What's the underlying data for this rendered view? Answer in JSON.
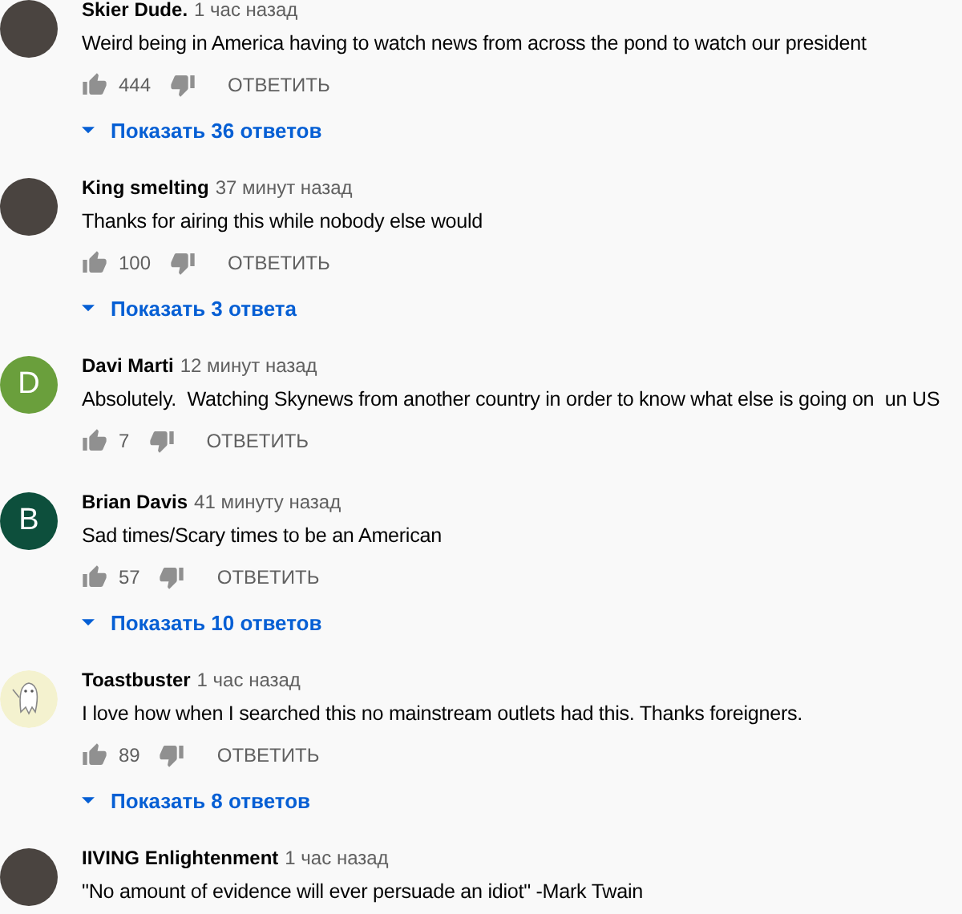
{
  "comments": [
    {
      "author": "Skier Dude.",
      "time": "1 час назад",
      "text": "Weird being in America having to watch news from across the pond to watch our president",
      "likes": "444",
      "reply_label": "ОТВЕТИТЬ",
      "replies": "Показать 36 ответов",
      "avatar": {
        "kind": "photo"
      }
    },
    {
      "author": "King smelting",
      "time": "37 минут назад",
      "text": "Thanks for airing this while nobody else would",
      "likes": "100",
      "reply_label": "ОТВЕТИТЬ",
      "replies": "Показать 3 ответа",
      "avatar": {
        "kind": "photo"
      }
    },
    {
      "author": "Davi Marti",
      "time": "12 минут назад",
      "text": "Absolutely.  Watching Skynews from another country in order to know what else is going on  un US",
      "likes": "7",
      "reply_label": "ОТВЕТИТЬ",
      "avatar": {
        "kind": "letter",
        "letter": "D",
        "color": "#6a9f3c"
      }
    },
    {
      "author": "Brian Davis",
      "time": "41 минуту назад",
      "text": "Sad times/Scary times to be an American",
      "likes": "57",
      "reply_label": "ОТВЕТИТЬ",
      "replies": "Показать 10 ответов",
      "avatar": {
        "kind": "letter",
        "letter": "B",
        "color": "#0d4f3c"
      }
    },
    {
      "author": "Toastbuster",
      "time": "1 час назад",
      "text": "I love how when I searched this no mainstream outlets had this. Thanks foreigners.",
      "likes": "89",
      "reply_label": "ОТВЕТИТЬ",
      "replies": "Показать 8 ответов",
      "avatar": {
        "kind": "drawing"
      }
    },
    {
      "author": "IIVING Enlightenment",
      "time": "1 час назад",
      "text": "\"No amount of evidence will ever persuade an idiot\" -Mark Twain",
      "avatar": {
        "kind": "photo"
      }
    }
  ]
}
